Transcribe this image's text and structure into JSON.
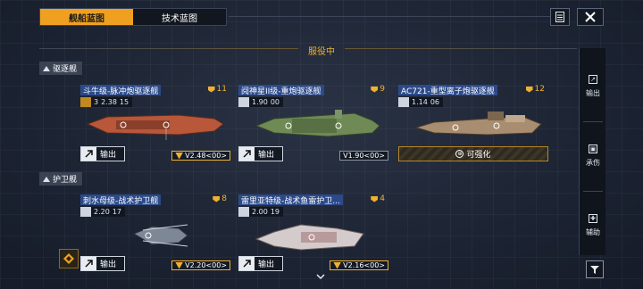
{
  "tabs": {
    "ship_blueprint": "舰船蓝图",
    "tech_blueprint": "技术蓝图"
  },
  "section_title": "服役中",
  "categories": {
    "destroyer": "驱逐舰",
    "frigate": "护卫舰"
  },
  "cards": [
    {
      "name": "斗牛级-脉冲炮驱逐舰",
      "rank": "11",
      "stat_level": "3",
      "stat_value": "2.38",
      "stat_extra": "15",
      "output_label": "输出",
      "version": "V2.48<00>",
      "version_gold": true,
      "hull_color": "#b8573a"
    },
    {
      "name": "阋神星II级-重炮驱逐舰",
      "rank": "9",
      "stat_value": "1.90",
      "stat_extra": "00",
      "output_label": "输出",
      "version": "V1.90<00>",
      "version_gold": false,
      "hull_color": "#6f8a55"
    },
    {
      "name": "AC721-重型离子炮驱逐舰",
      "rank": "12",
      "stat_value": "1.14",
      "stat_extra": "06",
      "strength_label": "可强化",
      "hull_color": "#a88d70"
    },
    {
      "name": "刺水母级-战术护卫舰",
      "rank": "8",
      "stat_value": "2.20",
      "stat_extra": "17",
      "output_label": "输出",
      "version": "V2.20<00>",
      "version_gold": true,
      "hull_color": "#7d8796"
    },
    {
      "name": "雷里亚特级-战术鱼雷护卫...",
      "rank": "4",
      "stat_value": "2.00",
      "stat_extra": "19",
      "output_label": "输出",
      "version": "V2.16<00>",
      "version_gold": true,
      "hull_color": "#d4cccc"
    }
  ],
  "rail": {
    "output": "输出",
    "tank": "承伤",
    "support": "辅助"
  },
  "icons": {
    "document": "document-icon",
    "close": "close-icon",
    "filter": "filter-icon",
    "chevron": "chevron-down-icon"
  },
  "colors": {
    "accent": "#f0a020",
    "background": "#1b2230",
    "name_bar": "#2c4a8a"
  }
}
